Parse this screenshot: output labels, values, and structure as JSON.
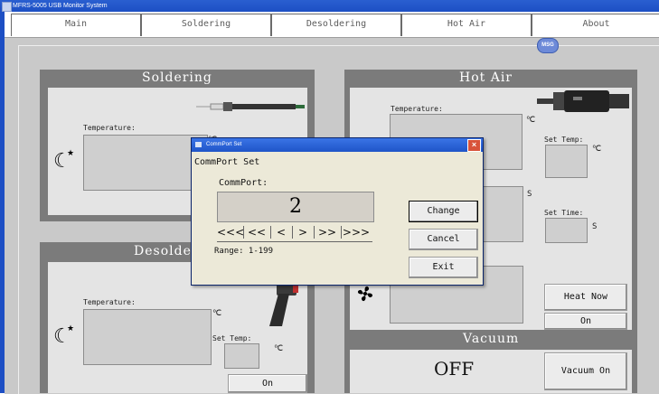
{
  "window": {
    "title": "MFRS-5005 USB  Monitor System"
  },
  "tabs": [
    "Main",
    "Soldering",
    "Desoldering",
    "Hot Air",
    "About"
  ],
  "msg_icon": "MSG",
  "soldering": {
    "title": "Soldering",
    "temperature_label": "Temperature:",
    "unit_c": "℃"
  },
  "desoldering": {
    "title": "Desoldering",
    "visible_title": "Desolde",
    "temperature_label": "Temperature:",
    "unit_c": "℃",
    "set_temp_label": "Set Temp:",
    "set_temp_unit": "℃",
    "on_button": "On"
  },
  "hot_air": {
    "title": "Hot Air",
    "temperature_label": "Temperature:",
    "unit_c": "℃",
    "unit_s": "S",
    "set_temp_label": "Set Temp:",
    "set_temp_unit": "℃",
    "set_time_label": "Set Time:",
    "set_time_unit": "S",
    "heat_now_button": "Heat Now",
    "on_button": "On"
  },
  "vacuum": {
    "title": "Vacuum",
    "status": "OFF",
    "button": "Vacuum On"
  },
  "dialog": {
    "title": "CommPort Set",
    "heading": "CommPort Set",
    "port_label": "CommPort:",
    "port_value": "2",
    "nav": [
      "<<<",
      "<<",
      "<",
      ">",
      ">>",
      ">>>"
    ],
    "range": "Range: 1-199",
    "change": "Change",
    "cancel": "Cancel",
    "exit": "Exit",
    "close_glyph": "×"
  },
  "icons": {
    "moon": "moon-star-icon",
    "fan": "fan-icon",
    "iron": "soldering-iron-icon",
    "gun": "desoldering-gun-icon",
    "hot_air_handle": "hot-air-handle-icon"
  }
}
